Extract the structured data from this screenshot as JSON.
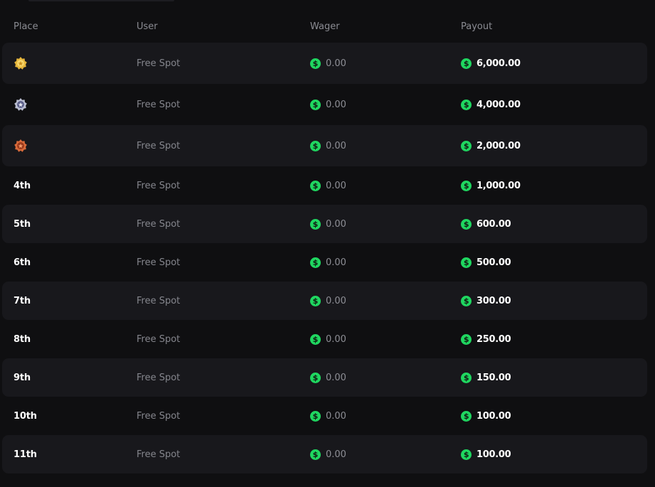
{
  "table": {
    "headers": {
      "place": "Place",
      "user": "User",
      "wager": "Wager",
      "payout": "Payout"
    },
    "rows": [
      {
        "place": "",
        "medal": "gold-medal-icon",
        "user": "Free Spot",
        "wager": "0.00",
        "payout": "6,000.00"
      },
      {
        "place": "",
        "medal": "silver-medal-icon",
        "user": "Free Spot",
        "wager": "0.00",
        "payout": "4,000.00"
      },
      {
        "place": "",
        "medal": "bronze-medal-icon",
        "user": "Free Spot",
        "wager": "0.00",
        "payout": "2,000.00"
      },
      {
        "place": "4th",
        "user": "Free Spot",
        "wager": "0.00",
        "payout": "1,000.00"
      },
      {
        "place": "5th",
        "user": "Free Spot",
        "wager": "0.00",
        "payout": "600.00"
      },
      {
        "place": "6th",
        "user": "Free Spot",
        "wager": "0.00",
        "payout": "500.00"
      },
      {
        "place": "7th",
        "user": "Free Spot",
        "wager": "0.00",
        "payout": "300.00"
      },
      {
        "place": "8th",
        "user": "Free Spot",
        "wager": "0.00",
        "payout": "250.00"
      },
      {
        "place": "9th",
        "user": "Free Spot",
        "wager": "0.00",
        "payout": "150.00"
      },
      {
        "place": "10th",
        "user": "Free Spot",
        "wager": "0.00",
        "payout": "100.00"
      },
      {
        "place": "11th",
        "user": "Free Spot",
        "wager": "0.00",
        "payout": "100.00"
      }
    ]
  },
  "colors": {
    "background": "#0f0f11",
    "row_alt": "#18181c",
    "coin": "#1fd760",
    "header_text": "#8b8c93",
    "muted_text": "#85868d",
    "gold": "#e5b53b",
    "silver": "#b9bdd0",
    "bronze": "#d86a3a"
  },
  "icons": {
    "currency": "dollar-coin-icon"
  }
}
